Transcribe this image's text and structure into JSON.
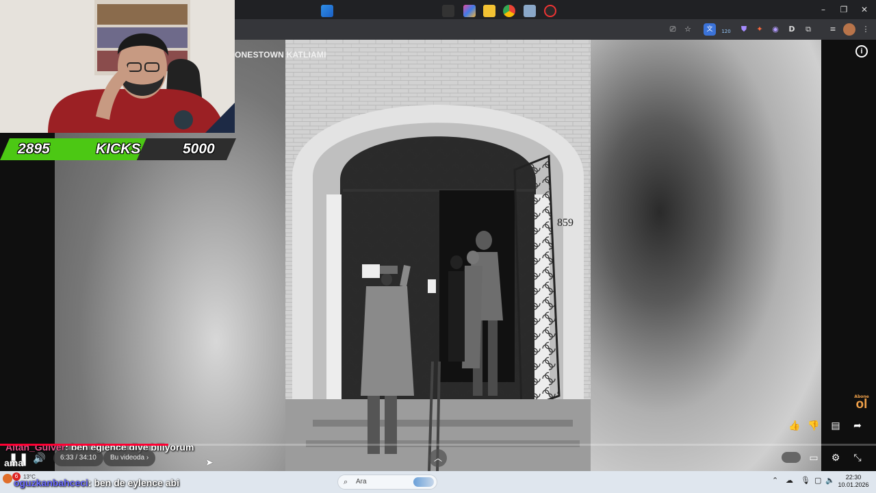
{
  "browser": {
    "minimize": "–",
    "maximize": "❐",
    "close": "✕",
    "badge_count": "120"
  },
  "video": {
    "title": "ONESTOWN KATLIAMI",
    "photo_number": "859",
    "time": "6:33 / 34:10",
    "chapter_label": "Bu videoda",
    "progress_fraction": 0.192
  },
  "stream_overlay": {
    "kicks_current": "2895",
    "kicks_label": "KICKS",
    "kicks_goal": "5000",
    "kicks_fraction": 0.579
  },
  "chat": [
    {
      "user": "Altan_Gulver",
      "message": ": ben eğlence diye biliyorum"
    },
    {
      "user": "oguzkanbahceci",
      "message": ": ben de eylence abi"
    }
  ],
  "corner": {
    "weather_temp": "13°C",
    "notification_count": "6",
    "ama_text": "ama",
    "abone_text": "Abone",
    "ol_text": "ol"
  },
  "taskbar": {
    "search_placeholder": "Ara",
    "time": "22:30",
    "date": "10.01.2026"
  },
  "colors": {
    "progress": "#ff0033",
    "kicks_green": "#4cc814",
    "chat_user1": "#e8528a",
    "chat_user2": "#6a6aff"
  }
}
